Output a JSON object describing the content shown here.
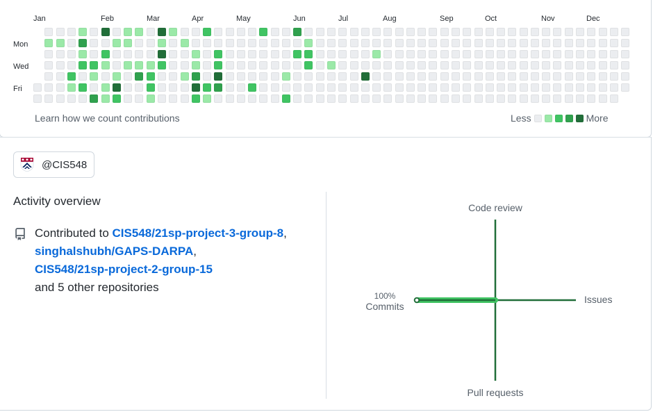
{
  "contribution_calendar": {
    "months": [
      "Jan",
      "Feb",
      "Mar",
      "Apr",
      "May",
      "Jun",
      "Jul",
      "Aug",
      "Sep",
      "Oct",
      "Nov",
      "Dec"
    ],
    "day_labels": [
      "Mon",
      "Wed",
      "Fri"
    ],
    "level_colors": [
      "#ebedf0",
      "#9be9a8",
      "#40c463",
      "#30a14e",
      "#216e39"
    ],
    "weeks": [
      [
        null,
        null,
        null,
        null,
        null,
        0,
        0
      ],
      [
        0,
        1,
        0,
        0,
        0,
        0,
        0
      ],
      [
        0,
        1,
        0,
        0,
        0,
        0,
        0
      ],
      [
        0,
        0,
        0,
        0,
        2,
        1,
        0
      ],
      [
        1,
        3,
        1,
        2,
        0,
        2,
        0
      ],
      [
        0,
        0,
        0,
        2,
        1,
        0,
        3
      ],
      [
        4,
        0,
        2,
        1,
        0,
        1,
        1
      ],
      [
        0,
        1,
        0,
        0,
        1,
        4,
        2
      ],
      [
        1,
        1,
        0,
        1,
        0,
        0,
        0
      ],
      [
        1,
        0,
        0,
        1,
        3,
        0,
        0
      ],
      [
        0,
        0,
        0,
        1,
        2,
        2,
        1
      ],
      [
        4,
        1,
        4,
        2,
        0,
        0,
        0
      ],
      [
        1,
        0,
        0,
        0,
        0,
        0,
        0
      ],
      [
        0,
        1,
        0,
        0,
        1,
        0,
        0
      ],
      [
        0,
        0,
        1,
        1,
        3,
        4,
        2
      ],
      [
        2,
        0,
        0,
        0,
        0,
        2,
        1
      ],
      [
        0,
        0,
        2,
        2,
        4,
        3,
        0
      ],
      [
        0,
        0,
        0,
        0,
        0,
        0,
        0
      ],
      [
        0,
        0,
        0,
        0,
        0,
        0,
        0
      ],
      [
        0,
        0,
        0,
        0,
        0,
        2,
        0
      ],
      [
        2,
        0,
        0,
        0,
        0,
        0,
        0
      ],
      [
        0,
        0,
        0,
        0,
        0,
        0,
        0
      ],
      [
        0,
        0,
        0,
        0,
        1,
        0,
        2
      ],
      [
        3,
        0,
        2,
        0,
        0,
        0,
        0
      ],
      [
        0,
        1,
        2,
        2,
        0,
        0,
        0
      ],
      [
        0,
        0,
        0,
        0,
        0,
        0,
        0
      ],
      [
        0,
        0,
        0,
        1,
        0,
        0,
        0
      ],
      [
        0,
        0,
        0,
        0,
        0,
        0,
        0
      ],
      [
        0,
        0,
        0,
        0,
        0,
        0,
        0
      ],
      [
        0,
        0,
        0,
        0,
        4,
        0,
        0
      ],
      [
        0,
        0,
        1,
        0,
        0,
        0,
        0
      ],
      [
        0,
        0,
        0,
        0,
        0,
        0,
        0
      ],
      [
        0,
        0,
        0,
        0,
        0,
        0,
        0
      ],
      [
        0,
        0,
        0,
        0,
        0,
        0,
        0
      ],
      [
        0,
        0,
        0,
        0,
        0,
        0,
        0
      ],
      [
        0,
        0,
        0,
        0,
        0,
        0,
        0
      ],
      [
        0,
        0,
        0,
        0,
        0,
        0,
        0
      ],
      [
        0,
        0,
        0,
        0,
        0,
        0,
        0
      ],
      [
        0,
        0,
        0,
        0,
        0,
        0,
        0
      ],
      [
        0,
        0,
        0,
        0,
        0,
        0,
        0
      ],
      [
        0,
        0,
        0,
        0,
        0,
        0,
        0
      ],
      [
        0,
        0,
        0,
        0,
        0,
        0,
        0
      ],
      [
        0,
        0,
        0,
        0,
        0,
        0,
        0
      ],
      [
        0,
        0,
        0,
        0,
        0,
        0,
        0
      ],
      [
        0,
        0,
        0,
        0,
        0,
        0,
        0
      ],
      [
        0,
        0,
        0,
        0,
        0,
        0,
        0
      ],
      [
        0,
        0,
        0,
        0,
        0,
        0,
        0
      ],
      [
        0,
        0,
        0,
        0,
        0,
        0,
        0
      ],
      [
        0,
        0,
        0,
        0,
        0,
        0,
        0
      ],
      [
        0,
        0,
        0,
        0,
        0,
        0,
        0
      ],
      [
        0,
        0,
        0,
        0,
        0,
        0,
        0
      ],
      [
        0,
        0,
        0,
        0,
        0,
        0,
        0
      ],
      [
        0,
        0,
        0,
        0,
        0,
        0,
        null
      ]
    ],
    "learn_link": "Learn how we count contributions",
    "legend": {
      "less": "Less",
      "more": "More"
    }
  },
  "org_filter": {
    "name": "@CIS548",
    "icon": "penn-shield-logo"
  },
  "activity_overview": {
    "title": "Activity overview",
    "icon": "repo-icon",
    "contributed_prefix": "Contributed to ",
    "repos": [
      "CIS548/21sp-project-3-group-8",
      "singhalshubh/GAPS-DARPA",
      "CIS548/21sp-project-2-group-15"
    ],
    "separator": ",",
    "others": "and 5 other repositories"
  },
  "activity_graph": {
    "axes": {
      "top": "Code review",
      "right": "Issues",
      "bottom": "Pull requests",
      "left": "Commits"
    },
    "percentages": {
      "commits": 100,
      "issues": 0,
      "code_review": 0,
      "pull_requests": 0
    },
    "commits_label": "100%",
    "accent": "#216e39",
    "fill": "#40c463"
  }
}
